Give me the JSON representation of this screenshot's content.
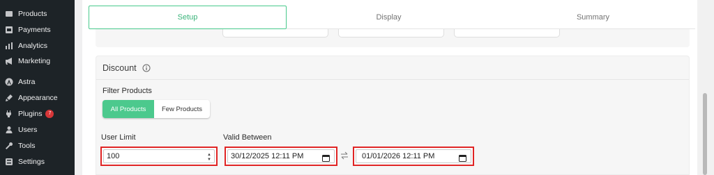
{
  "sidebar": {
    "items": [
      {
        "label": "Products",
        "icon": "products-icon"
      },
      {
        "label": "Payments",
        "icon": "payments-icon"
      },
      {
        "label": "Analytics",
        "icon": "analytics-icon"
      },
      {
        "label": "Marketing",
        "icon": "marketing-icon"
      },
      {
        "label": "Astra",
        "icon": "astra-icon"
      },
      {
        "label": "Appearance",
        "icon": "appearance-icon"
      },
      {
        "label": "Plugins",
        "icon": "plugins-icon",
        "badge": "7"
      },
      {
        "label": "Users",
        "icon": "users-icon"
      },
      {
        "label": "Tools",
        "icon": "tools-icon"
      },
      {
        "label": "Settings",
        "icon": "settings-icon"
      }
    ]
  },
  "tabs": [
    {
      "label": "Setup",
      "active": true
    },
    {
      "label": "Display",
      "active": false
    },
    {
      "label": "Summary",
      "active": false
    }
  ],
  "discount": {
    "title": "Discount",
    "filter_label": "Filter Products",
    "filter_options": [
      "All Products",
      "Few Products"
    ],
    "filter_selected": "All Products",
    "user_limit_label": "User Limit",
    "user_limit_value": "100",
    "valid_between_label": "Valid Between",
    "valid_from": "30/12/2025 12:11 PM",
    "valid_to": "01/01/2026 12:11 PM"
  },
  "colors": {
    "accent": "#4cc98d",
    "highlight": "#e02424",
    "sidebar_bg": "#1d2327",
    "badge": "#d63638"
  }
}
